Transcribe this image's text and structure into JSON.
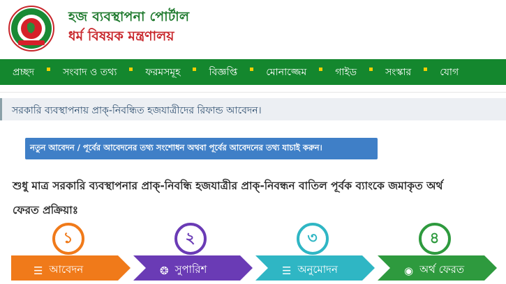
{
  "header": {
    "portal_title": "হজ ব্যবস্থাপনা পোর্টাল",
    "ministry_title": "ধর্ম বিষয়ক মন্ত্রণালয়",
    "logo_icon": "government-seal-icon"
  },
  "nav": {
    "items": [
      {
        "label": "প্রচ্ছদ"
      },
      {
        "label": "সংবাদ ও তথ্য"
      },
      {
        "label": "ফরমসমূহ"
      },
      {
        "label": "বিজ্ঞপ্তি"
      },
      {
        "label": "মোনাজ্জেম"
      },
      {
        "label": "গাইড"
      },
      {
        "label": "সংস্কার"
      },
      {
        "label": "যোগ"
      }
    ]
  },
  "page": {
    "heading": "সরকারি ব্যবস্থাপনায় প্রাক্-নিবন্ধিত হজযাত্রীদের রিফান্ড আবেদন।",
    "info_button": "নতুন আবেদন / পূর্বের আবেদনের তথ্য সংশোধন অথবা পূর্বের আবেদনের তথ্য যাচাই করুন।",
    "desc_line1": "শুধু মাত্র সরকারি ব্যবস্থাপনার প্রাক্-নিবন্ধি হজযাত্রীর প্রাক্-নিবন্ধন বাতিল পূর্বক ব্যাংকে জমাকৃত অর্থ",
    "desc_line2": "ফেরত প্রক্রিয়াঃ"
  },
  "steps": [
    {
      "number": "১",
      "label": "আবেদন",
      "icon": "document-icon",
      "color": "#f07a1a",
      "ring": "#f07a1a",
      "num_color": "#f07a1a"
    },
    {
      "number": "২",
      "label": "সুপারিশ",
      "icon": "badge-icon",
      "color": "#6a3bb5",
      "ring": "#6a3bb5",
      "num_color": "#6a3bb5"
    },
    {
      "number": "৩",
      "label": "অনুমোদন",
      "icon": "document-icon",
      "color": "#2fb6c4",
      "ring": "#2fb6c4",
      "num_color": "#2fb6c4"
    },
    {
      "number": "৪",
      "label": "অর্থ ফেরত",
      "icon": "money-icon",
      "color": "#2e9a3e",
      "ring": "#2e9a3e",
      "num_color": "#2e9a3e"
    }
  ],
  "colors": {
    "nav_bg": "#14872e",
    "nav_separator": "#f2d000",
    "portal_title": "#1f7a2e",
    "ministry_title": "#c8262b",
    "info_button_bg": "#3f7fc7"
  }
}
